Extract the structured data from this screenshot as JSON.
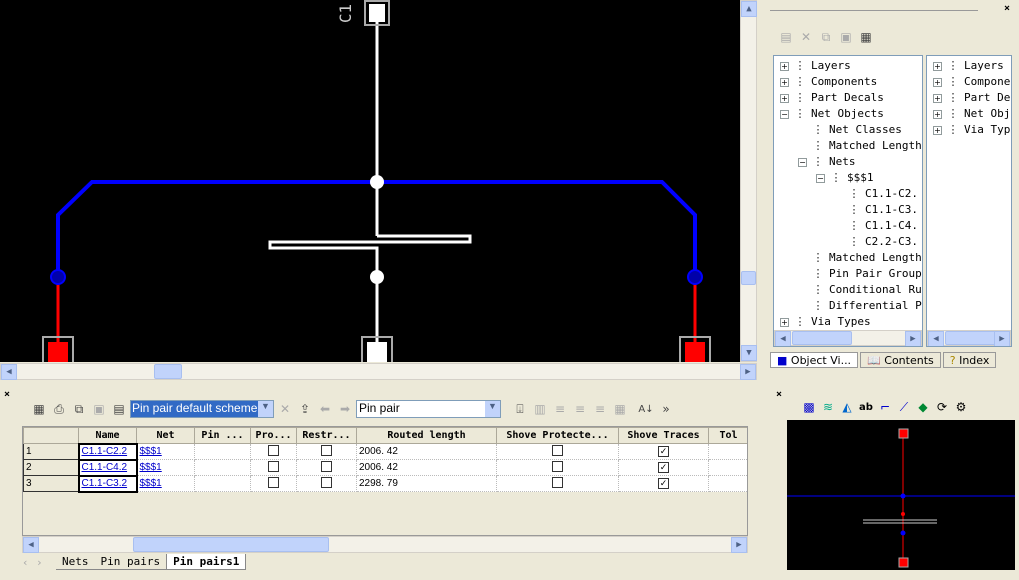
{
  "canvas": {
    "refdes": "C1"
  },
  "object_view": {
    "tree_left": [
      {
        "label": "Layers",
        "icon": "layers-icon",
        "level": 0,
        "expander": "+"
      },
      {
        "label": "Components",
        "icon": "components-icon",
        "level": 0,
        "expander": "+"
      },
      {
        "label": "Part Decals",
        "icon": "part-decals-icon",
        "level": 0,
        "expander": "+"
      },
      {
        "label": "Net Objects",
        "icon": "net-objects-icon",
        "level": 0,
        "expander": "-"
      },
      {
        "label": "Net Classes",
        "icon": "net-classes-icon",
        "level": 1,
        "expander": ""
      },
      {
        "label": "Matched Length",
        "icon": "matched-length-icon",
        "level": 1,
        "expander": ""
      },
      {
        "label": "Nets",
        "icon": "nets-icon",
        "level": 1,
        "expander": "-"
      },
      {
        "label": "$$$1",
        "icon": "net-icon",
        "level": 2,
        "expander": "-"
      },
      {
        "label": "C1.1-C2.",
        "icon": "pin-pair-icon",
        "level": 3,
        "expander": ""
      },
      {
        "label": "C1.1-C3.",
        "icon": "pin-pair-icon",
        "level": 3,
        "expander": ""
      },
      {
        "label": "C1.1-C4.",
        "icon": "pin-pair-icon",
        "level": 3,
        "expander": ""
      },
      {
        "label": "C2.2-C3.",
        "icon": "pin-pair-icon",
        "level": 3,
        "expander": ""
      },
      {
        "label": "Matched Length",
        "icon": "matched-length-pin-pair-icon",
        "level": 1,
        "expander": ""
      },
      {
        "label": "Pin Pair Group",
        "icon": "pin-pair-group-icon",
        "level": 1,
        "expander": ""
      },
      {
        "label": "Conditional Ru",
        "icon": "conditional-rules-icon",
        "level": 1,
        "expander": ""
      },
      {
        "label": "Differential P",
        "icon": "differential-pair-icon",
        "level": 1,
        "expander": ""
      },
      {
        "label": "Via Types",
        "icon": "via-types-icon",
        "level": 0,
        "expander": "+"
      }
    ],
    "tree_right": [
      {
        "label": "Layers",
        "icon": "layers-icon"
      },
      {
        "label": "Compone",
        "icon": "components-icon"
      },
      {
        "label": "Part De",
        "icon": "part-decals-icon"
      },
      {
        "label": "Net Obj",
        "icon": "net-objects-icon"
      },
      {
        "label": "Via Typ",
        "icon": "via-types-icon"
      }
    ],
    "tabs": [
      "Object Vi...",
      "Contents",
      "Index"
    ]
  },
  "spreadsheet": {
    "scheme": "Pin pair default scheme",
    "object_type": "Pin pair",
    "columns": [
      "",
      "Name",
      "Net",
      "Pin ...",
      "Pro...",
      "Restr...",
      "Routed length",
      "Shove Protecte...",
      "Shove Traces",
      "Tol"
    ],
    "rows": [
      {
        "num": "1",
        "name": "C1.1-C2.2",
        "net": "$$$1",
        "pro": false,
        "restr": false,
        "length": "2006. 42",
        "shove_protected": false,
        "shove_traces": true
      },
      {
        "num": "2",
        "name": "C1.1-C4.2",
        "net": "$$$1",
        "pro": false,
        "restr": false,
        "length": "2006. 42",
        "shove_protected": false,
        "shove_traces": true
      },
      {
        "num": "3",
        "name": "C1.1-C3.2",
        "net": "$$$1",
        "pro": false,
        "restr": false,
        "length": "2298. 79",
        "shove_protected": false,
        "shove_traces": true
      }
    ],
    "sheet_tabs": [
      "Nets",
      "Pin pairs",
      "Pin pairs1"
    ],
    "active_sheet": "Pin pairs1"
  },
  "colors": {
    "canvas_bg": "#000000",
    "trace_blue": "#0000ff",
    "trace_red": "#ff0000",
    "trace_white": "#ffffff",
    "selection": "#316ac5"
  }
}
